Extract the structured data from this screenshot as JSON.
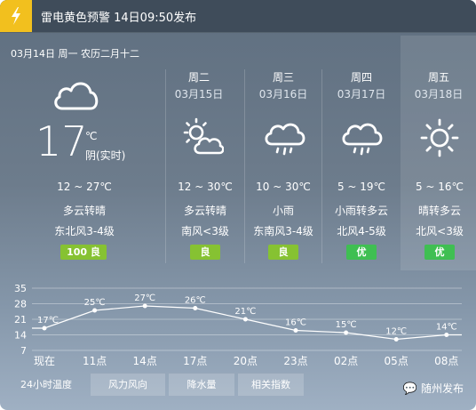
{
  "alert": {
    "text": "雷电黄色预警 14日09:50发布",
    "icon": "lightning-icon",
    "color": "#f2c01e"
  },
  "date_line": "03月14日 周一 农历二月十二",
  "today": {
    "icon": "cloudy-icon",
    "temp": "17",
    "unit": "℃",
    "note": "阴(实时)",
    "range": "12 ~ 27℃",
    "condition": "多云转晴",
    "wind": "东北风3-4级",
    "aqi": "100 良"
  },
  "days": [
    {
      "weekday": "周二",
      "date": "03月15日",
      "icon": "partly-cloudy-icon",
      "range": "12 ~ 30℃",
      "condition": "多云转晴",
      "wind": "南风<3级",
      "aqi": "良",
      "aqi_level": "good"
    },
    {
      "weekday": "周三",
      "date": "03月16日",
      "icon": "rain-icon",
      "range": "10 ~ 30℃",
      "condition": "小雨",
      "wind": "东南风3-4级",
      "aqi": "良",
      "aqi_level": "good"
    },
    {
      "weekday": "周四",
      "date": "03月17日",
      "icon": "rain-icon",
      "range": "5 ~ 19℃",
      "condition": "小雨转多云",
      "wind": "北风4-5级",
      "aqi": "优",
      "aqi_level": "excellent"
    },
    {
      "weekday": "周五",
      "date": "03月18日",
      "icon": "sunny-icon",
      "range": "5 ~ 16℃",
      "condition": "晴转多云",
      "wind": "北风<3级",
      "aqi": "优",
      "aqi_level": "excellent"
    }
  ],
  "chart_data": {
    "type": "line",
    "categories": [
      "现在",
      "11点",
      "14点",
      "17点",
      "20点",
      "23点",
      "02点",
      "05点",
      "08点"
    ],
    "values": [
      17,
      25,
      27,
      26,
      21,
      16,
      15,
      12,
      14
    ],
    "data_labels": [
      "17℃",
      "25℃",
      "27℃",
      "26℃",
      "21℃",
      "16℃",
      "15℃",
      "12℃",
      "14℃"
    ],
    "yticks": [
      35,
      28,
      21,
      14,
      7
    ],
    "ylim": [
      7,
      35
    ],
    "grid": true
  },
  "tabs": [
    {
      "label": "24小时温度",
      "active": true
    },
    {
      "label": "风力风向",
      "active": false
    },
    {
      "label": "降水量",
      "active": false
    },
    {
      "label": "相关指数",
      "active": false
    }
  ],
  "brand": "随州发布"
}
